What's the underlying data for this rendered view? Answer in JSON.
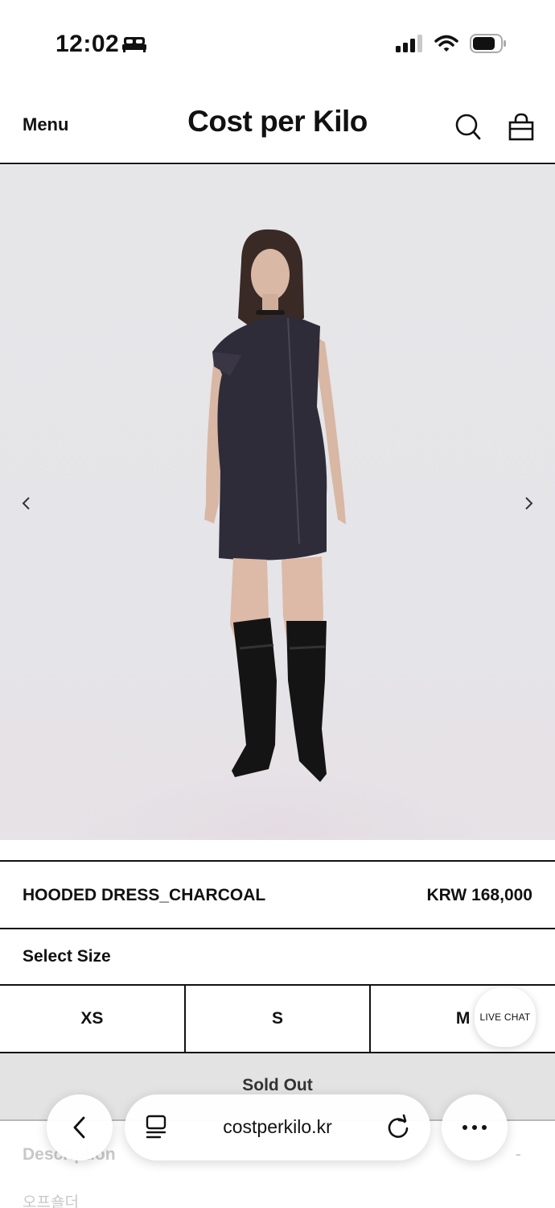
{
  "status_bar": {
    "time": "12:02",
    "icons": [
      "bed-icon",
      "signal-icon",
      "wifi-icon",
      "battery-icon"
    ]
  },
  "header": {
    "menu_label": "Menu",
    "brand": "Cost per Kilo",
    "icons": [
      "search-icon",
      "shopping-bag-icon"
    ]
  },
  "gallery": {
    "image": "model-wearing-charcoal-dress-photo",
    "prev_icon": "chevron-left-icon",
    "next_icon": "chevron-right-icon"
  },
  "product": {
    "name": "HOODED DRESS_CHARCOAL",
    "price": "KRW 168,000"
  },
  "size": {
    "label": "Select Size",
    "options": [
      "XS",
      "S",
      "M"
    ]
  },
  "sold_out_label": "Sold Out",
  "description": {
    "label": "Description",
    "toggle": "-",
    "text": "오프숄더"
  },
  "live_chat_label": "LIVE CHAT",
  "browser": {
    "url": "costperkilo.kr",
    "icons": [
      "back-arrow-icon",
      "reader-icon",
      "reload-icon",
      "more-icon"
    ]
  },
  "colors": {
    "text": "#111111",
    "hero_bg": "#e6e6e9",
    "sold_out_bg": "#e3e3e3",
    "muted": "#c8c8c8"
  }
}
